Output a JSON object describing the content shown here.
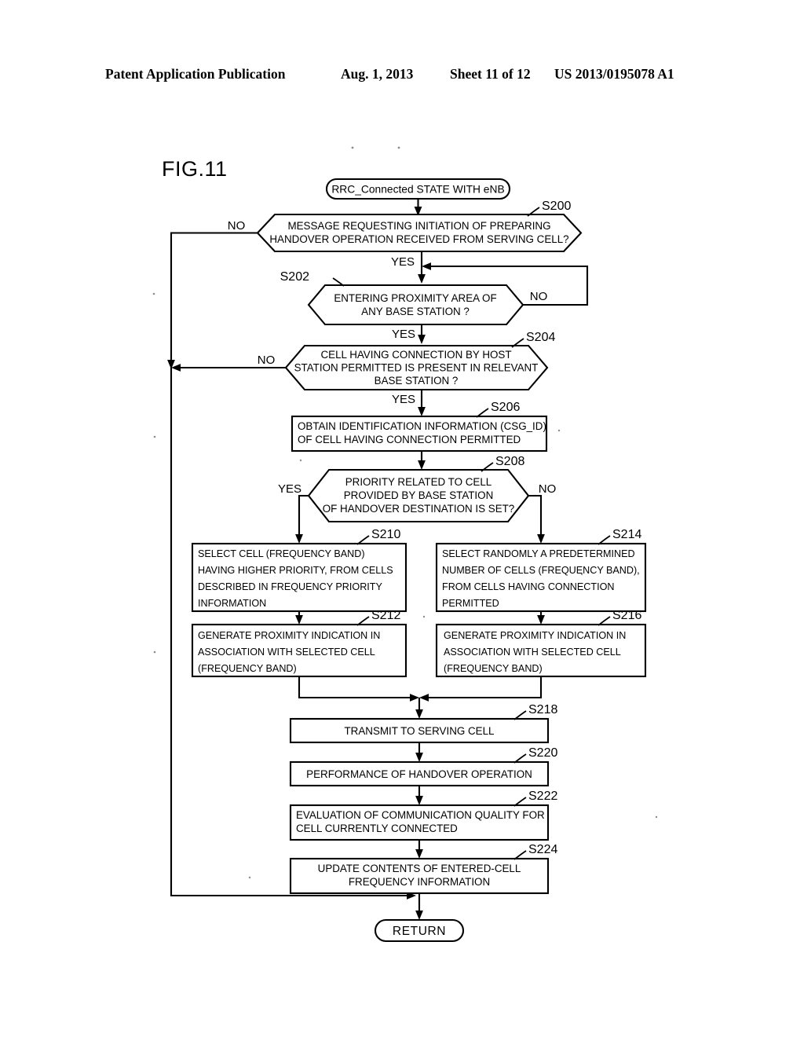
{
  "header": {
    "publication": "Patent Application Publication",
    "date": "Aug. 1, 2013",
    "sheet": "Sheet 11 of 12",
    "number": "US 2013/0195078 A1"
  },
  "figure": {
    "label": "FIG.11"
  },
  "chart_data": {
    "type": "diagram",
    "diagram_type": "flowchart",
    "title": "FIG.11",
    "terminals": {
      "start": "RRC_Connected STATE WITH eNB",
      "end": "RETURN"
    },
    "nodes": [
      {
        "id": "S200",
        "step": "S200",
        "shape": "decision",
        "lines": [
          "MESSAGE REQUESTING INITIATION OF PREPARING",
          "HANDOVER OPERATION RECEIVED FROM SERVING CELL?"
        ],
        "yes": "YES",
        "no": "NO"
      },
      {
        "id": "S202",
        "step": "S202",
        "shape": "decision",
        "lines": [
          "ENTERING PROXIMITY AREA OF",
          "ANY BASE STATION ?"
        ],
        "yes": "YES",
        "no": "NO"
      },
      {
        "id": "S204",
        "step": "S204",
        "shape": "decision",
        "lines": [
          "CELL HAVING CONNECTION BY HOST",
          "STATION PERMITTED IS PRESENT IN RELEVANT",
          "BASE STATION ?"
        ],
        "yes": "YES",
        "no": "NO"
      },
      {
        "id": "S206",
        "step": "S206",
        "shape": "process",
        "lines": [
          "OBTAIN IDENTIFICATION INFORMATION (CSG_ID)",
          "OF CELL HAVING CONNECTION PERMITTED"
        ]
      },
      {
        "id": "S208",
        "step": "S208",
        "shape": "decision",
        "lines": [
          "PRIORITY RELATED TO CELL",
          "PROVIDED BY BASE STATION",
          "OF HANDOVER DESTINATION IS SET?"
        ],
        "yes": "YES",
        "no": "NO"
      },
      {
        "id": "S210",
        "step": "S210",
        "shape": "process",
        "lines": [
          "SELECT CELL (FREQUENCY BAND)",
          "HAVING HIGHER PRIORITY, FROM CELLS",
          "DESCRIBED IN FREQUENCY PRIORITY",
          "INFORMATION"
        ]
      },
      {
        "id": "S212",
        "step": "S212",
        "shape": "process",
        "lines": [
          "GENERATE PROXIMITY INDICATION IN",
          "ASSOCIATION WITH SELECTED CELL",
          "(FREQUENCY BAND)"
        ]
      },
      {
        "id": "S214",
        "step": "S214",
        "shape": "process",
        "lines": [
          "SELECT RANDOMLY A PREDETERMINED",
          "NUMBER OF CELLS (FREQUENCY BAND),",
          "FROM CELLS HAVING CONNECTION",
          "PERMITTED"
        ]
      },
      {
        "id": "S216",
        "step": "S216",
        "shape": "process",
        "lines": [
          "GENERATE PROXIMITY INDICATION IN",
          "ASSOCIATION WITH SELECTED CELL",
          "(FREQUENCY BAND)"
        ]
      },
      {
        "id": "S218",
        "step": "S218",
        "shape": "process",
        "lines": [
          "TRANSMIT TO SERVING CELL"
        ]
      },
      {
        "id": "S220",
        "step": "S220",
        "shape": "process",
        "lines": [
          "PERFORMANCE OF HANDOVER OPERATION"
        ]
      },
      {
        "id": "S222",
        "step": "S222",
        "shape": "process",
        "lines": [
          "EVALUATION OF COMMUNICATION QUALITY FOR",
          "CELL CURRENTLY CONNECTED"
        ]
      },
      {
        "id": "S224",
        "step": "S224",
        "shape": "process",
        "lines": [
          "UPDATE CONTENTS OF ENTERED-CELL",
          "FREQUENCY INFORMATION"
        ]
      }
    ],
    "edges": [
      {
        "from": "start",
        "to": "S200",
        "label": ""
      },
      {
        "from": "S200",
        "to": "S202",
        "label": "YES"
      },
      {
        "from": "S200",
        "to": "return-path",
        "label": "NO"
      },
      {
        "from": "S202",
        "to": "S204",
        "label": "YES"
      },
      {
        "from": "S202",
        "to": "S202-entry",
        "label": "NO"
      },
      {
        "from": "S204",
        "to": "S206",
        "label": "YES"
      },
      {
        "from": "S204",
        "to": "return-path",
        "label": "NO"
      },
      {
        "from": "S206",
        "to": "S208",
        "label": ""
      },
      {
        "from": "S208",
        "to": "S210",
        "label": "YES"
      },
      {
        "from": "S208",
        "to": "S214",
        "label": "NO"
      },
      {
        "from": "S210",
        "to": "S212",
        "label": ""
      },
      {
        "from": "S214",
        "to": "S216",
        "label": ""
      },
      {
        "from": "S212",
        "to": "S218",
        "label": ""
      },
      {
        "from": "S216",
        "to": "S218",
        "label": ""
      },
      {
        "from": "S218",
        "to": "S220",
        "label": ""
      },
      {
        "from": "S220",
        "to": "S222",
        "label": ""
      },
      {
        "from": "S222",
        "to": "S224",
        "label": ""
      },
      {
        "from": "S224",
        "to": "end",
        "label": ""
      }
    ],
    "labels": {
      "s200_no": "NO",
      "s200_yes": "YES",
      "s202_step": "S202",
      "s202_no": "NO",
      "s202_yes": "YES",
      "s204_no": "NO",
      "s204_yes": "YES",
      "s208_yes": "YES",
      "s208_no": "NO"
    },
    "colors": {
      "ink": "#000000",
      "paper": "#ffffff"
    }
  }
}
